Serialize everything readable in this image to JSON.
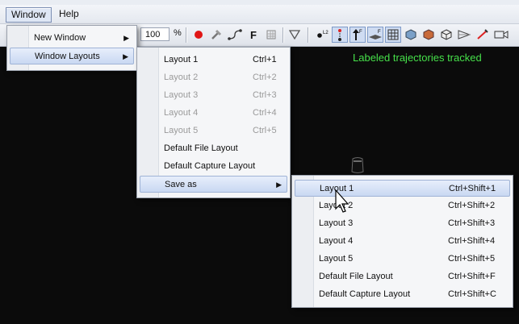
{
  "menubar": {
    "window": "Window",
    "help": "Help"
  },
  "toolbar": {
    "zoom_value": "100",
    "zoom_unit": "%"
  },
  "status": {
    "text": "Labeled trajectories tracked",
    "color": "#46e04a"
  },
  "window_menu": {
    "items": [
      {
        "label": "New Window"
      },
      {
        "label": "Window Layouts"
      }
    ]
  },
  "layouts_menu": {
    "items": [
      {
        "label": "Layout 1",
        "shortcut": "Ctrl+1"
      },
      {
        "label": "Layout 2",
        "shortcut": "Ctrl+2"
      },
      {
        "label": "Layout 3",
        "shortcut": "Ctrl+3"
      },
      {
        "label": "Layout 4",
        "shortcut": "Ctrl+4"
      },
      {
        "label": "Layout 5",
        "shortcut": "Ctrl+5"
      },
      {
        "label": "Default File Layout"
      },
      {
        "label": "Default Capture Layout"
      },
      {
        "label": "Save as"
      }
    ]
  },
  "saveas_menu": {
    "items": [
      {
        "label": "Layout 1",
        "shortcut": "Ctrl+Shift+1"
      },
      {
        "label": "Layout 2",
        "shortcut": "Ctrl+Shift+2"
      },
      {
        "label": "Layout 3",
        "shortcut": "Ctrl+Shift+3"
      },
      {
        "label": "Layout 4",
        "shortcut": "Ctrl+Shift+4"
      },
      {
        "label": "Layout 5",
        "shortcut": "Ctrl+Shift+5"
      },
      {
        "label": "Default File Layout",
        "shortcut": "Ctrl+Shift+F"
      },
      {
        "label": "Default Capture Layout",
        "shortcut": "Ctrl+Shift+C"
      }
    ]
  }
}
